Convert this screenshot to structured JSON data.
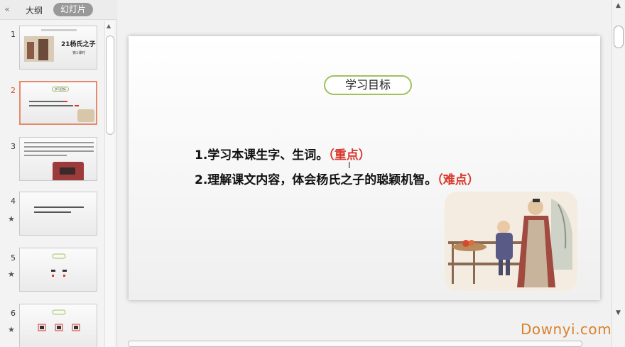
{
  "sidebar": {
    "collapse_icon": "double-chevron-left-icon",
    "tabs": [
      {
        "label": "大纲"
      },
      {
        "label": "幻灯片"
      }
    ],
    "thumbnails": [
      {
        "number": "1",
        "title": "21杨氏之子",
        "subtitle": "第1课时"
      },
      {
        "number": "2",
        "pill": "学习目标"
      },
      {
        "number": "3"
      },
      {
        "number": "4",
        "star_icon": "star-icon"
      },
      {
        "number": "5",
        "star_icon": "star-icon"
      },
      {
        "number": "6",
        "star_icon": "star-icon"
      }
    ]
  },
  "slide": {
    "title": "学习目标",
    "objectives": [
      {
        "text": "1.学习本课生字、生词。",
        "tag": "（重点）"
      },
      {
        "text": "2.理解课文内容，体会杨氏之子的聪颖机智。",
        "tag": "（难点）"
      }
    ]
  },
  "watermark": "Downyi.com",
  "colors": {
    "accent": "#d8372a",
    "pill_border": "#9ec25a",
    "active_thumb_border": "#e58a6b",
    "watermark": "#d9822b"
  }
}
